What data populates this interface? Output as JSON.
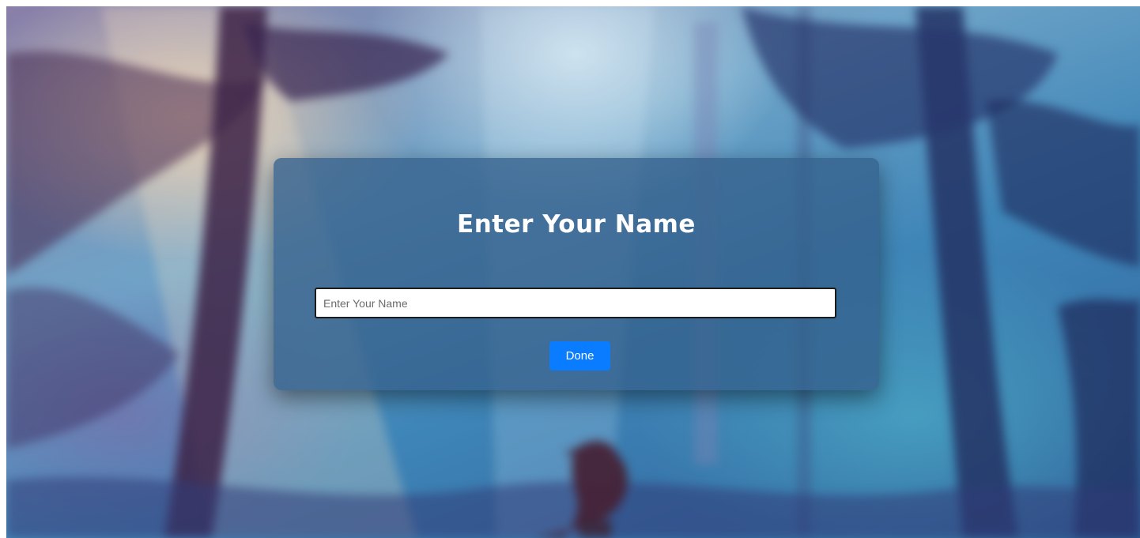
{
  "dialog": {
    "title": "Enter Your Name",
    "name_input": {
      "value": "",
      "placeholder": "Enter Your Name"
    },
    "done_label": "Done"
  },
  "colors": {
    "card_background": "#34608c",
    "button_accent": "#0a7cff",
    "text_light": "#ffffff"
  }
}
